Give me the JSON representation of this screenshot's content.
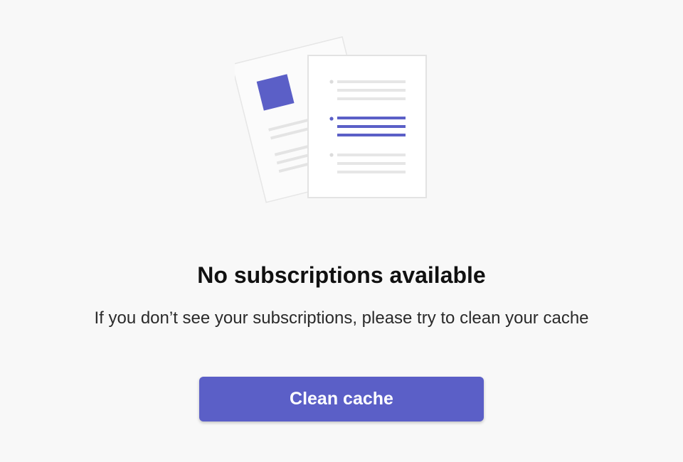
{
  "empty_state": {
    "title": "No subscriptions available",
    "message": "If you don’t see your subscriptions, please try to clean your cache",
    "illustration_icon": "documents-illustration-icon",
    "button": {
      "label": "Clean cache"
    }
  },
  "colors": {
    "accent": "#5b5fc7",
    "background": "#f8f8f8",
    "line_gray": "#e4e4e4"
  }
}
